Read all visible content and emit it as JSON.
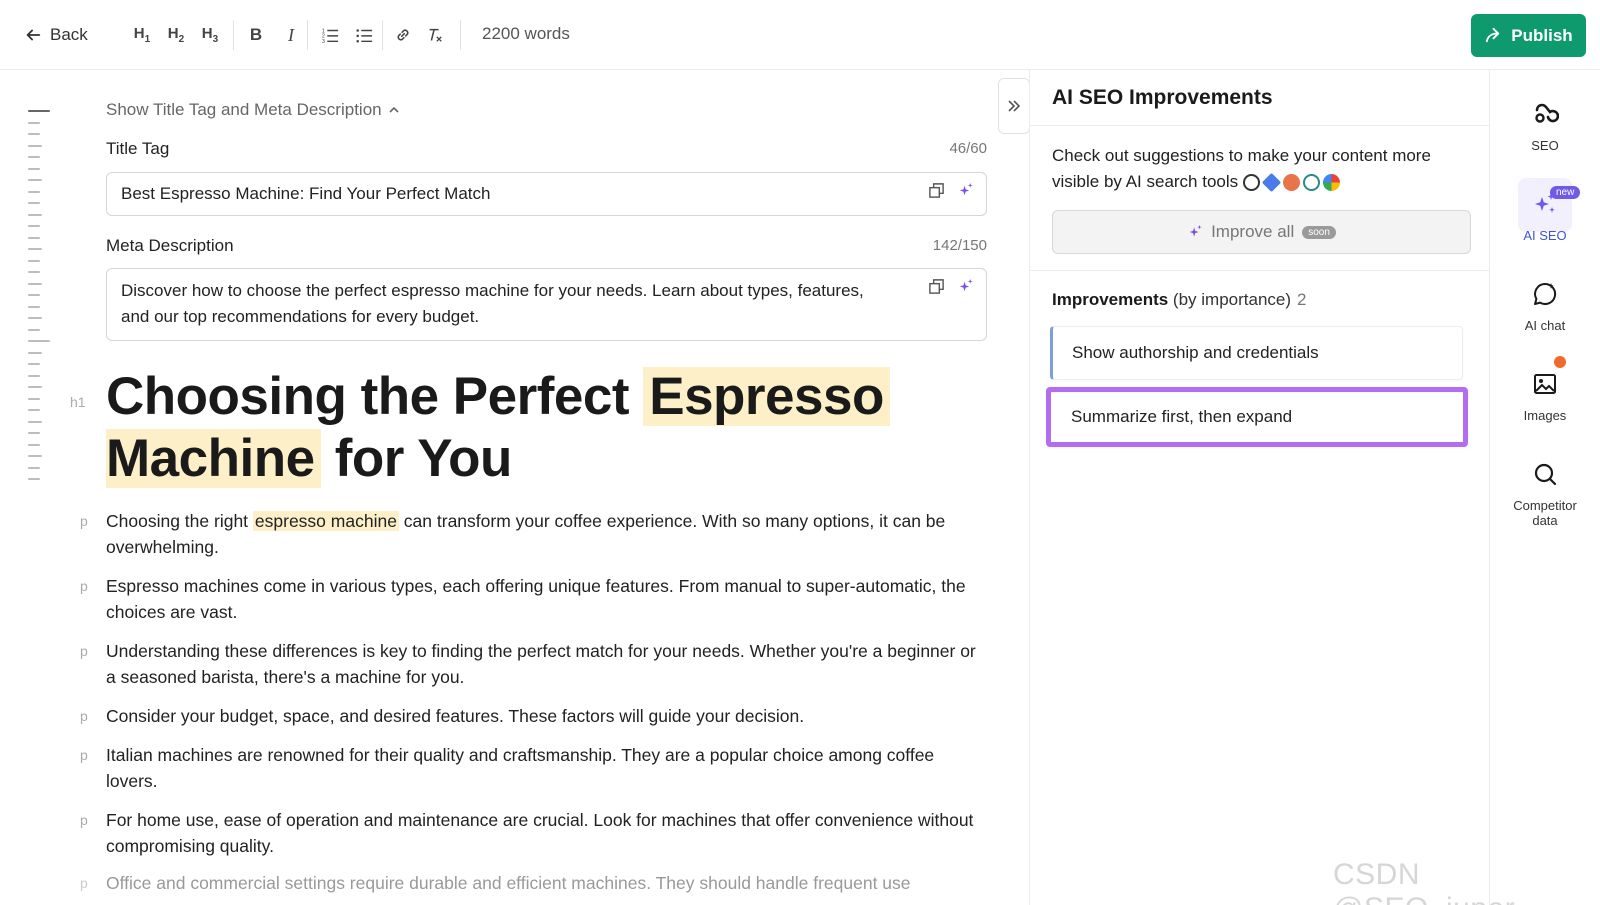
{
  "toolbar": {
    "back_label": "Back",
    "format_buttons": [
      "H1",
      "H2",
      "H3",
      "B",
      "I"
    ],
    "word_count": "2200 words",
    "publish_label": "Publish"
  },
  "editor": {
    "meta_toggle_label": "Show Title Tag and Meta Description",
    "title_tag": {
      "label": "Title Tag",
      "count": "46/60",
      "value": "Best Espresso Machine: Find Your Perfect Match"
    },
    "meta_description": {
      "label": "Meta Description",
      "count": "142/150",
      "value": "Discover how to choose the perfect espresso machine for your needs. Learn about types, features, and our top recommendations for every budget."
    },
    "h1_tag": "h1",
    "heading": {
      "pre": "Choosing the Perfect ",
      "hl1": "Espresso",
      "hl2": "Machine",
      "post": " for You"
    },
    "p_tag": "p",
    "p1": {
      "pre": "Choosing the right ",
      "hl": "espresso machine",
      "post": " can transform your coffee experience. With so many options, it can be overwhelming."
    },
    "paragraphs": [
      "Espresso machines come in various types, each offering unique features. From manual to super-automatic, the choices are vast.",
      "Understanding these differences is key to finding the perfect match for your needs. Whether you're a beginner or a seasoned barista, there's a machine for you.",
      "Consider your budget, space, and desired features. These factors will guide your decision.",
      "Italian machines are renowned for their quality and craftsmanship. They are a popular choice among coffee lovers.",
      "For home use, ease of operation and maintenance are crucial. Look for machines that offer convenience without compromising quality.",
      "Office and commercial settings require durable and efficient machines. They should handle frequent use"
    ]
  },
  "panel": {
    "title": "AI SEO Improvements",
    "desc": "Check out suggestions to make your content more visible by AI search tools",
    "improve_all_label": "Improve all",
    "soon_badge": "soon",
    "improvements_bold": "Improvements",
    "improvements_rest": " (by importance)",
    "improvements_count": "2",
    "items": [
      "Show authorship and credentials",
      "Summarize first, then expand"
    ]
  },
  "rail": {
    "seo": "SEO",
    "ai_seo": "AI SEO",
    "new_badge": "new",
    "ai_chat": "AI chat",
    "images": "Images",
    "competitor_line1": "Competitor",
    "competitor_line2": "data"
  },
  "watermark": "CSDN @SEO_juper",
  "colors": {
    "publish": "#0f9a6e",
    "active": "#3e55d6",
    "selected_border": "#b46cf0",
    "highlight": "#fdf0c8",
    "notification_dot": "#f06a2d"
  }
}
